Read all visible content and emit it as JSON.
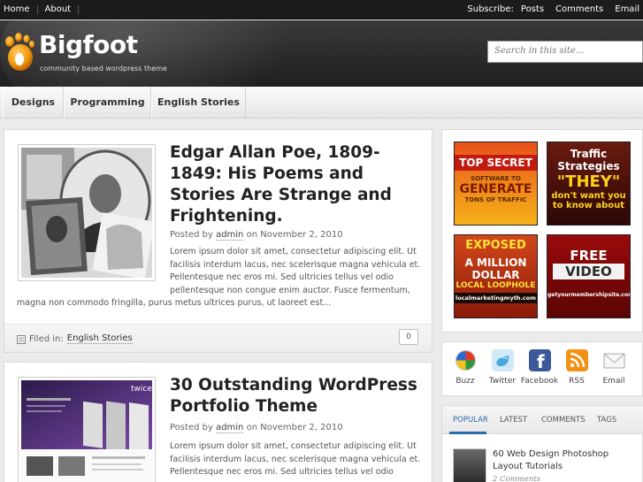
{
  "topbar": {
    "links": [
      "Home",
      "About"
    ],
    "subscribe_label": "Subscribe:",
    "subscribe_links": [
      "Posts",
      "Comments",
      "Email"
    ]
  },
  "header": {
    "site_title": "Bigfoot",
    "tagline": "community based wordpress theme",
    "search_placeholder": "Search in this site..."
  },
  "nav": {
    "items": [
      "Designs",
      "Programming",
      "English Stories"
    ]
  },
  "posts": [
    {
      "title": "Edgar Allan Poe, 1809-1849: His Poems and Stories Are Strange and Frightening.",
      "posted_by": "Posted by",
      "author": "admin",
      "date": "on November 2, 2010",
      "excerpt_lines": [
        "Lorem ipsum dolor sit amet, consectetur adipiscing elit. Ut",
        "facilisis interdum lacus, nec scelerisque magna vehicula et.",
        "Pellentesque nec eros mi. Sed ultricies tellus vel odio",
        "pellentesque non congue enim auctor. Fusce fermentum,",
        "magna non commodo fringilla, purus metus ultrices purus, ut laoreet est..."
      ],
      "filed_label": "Filed in:",
      "category": "English Stories",
      "comment_count": "0"
    },
    {
      "title": "30 Outstanding WordPress Portfolio Theme",
      "posted_by": "Posted by",
      "author": "admin",
      "date": "on November 2, 2010",
      "excerpt_lines": [
        "Lorem ipsum dolor sit amet, consectetur adipiscing elit. Ut",
        "facilisis interdum lacus, nec scelerisque magna vehicula et.",
        "Pellentesque nec eros mi. Sed ultricies tellus vel odio"
      ]
    }
  ],
  "ads": [
    {
      "lines": [
        "TOP SECRET",
        "SOFTWARE TO",
        "GENERATE",
        "TONS OF TRAFFIC"
      ]
    },
    {
      "lines": [
        "Traffic",
        "Strategies",
        "\"THEY\"",
        "don't want you",
        "to know about"
      ]
    },
    {
      "lines": [
        "EXPOSED",
        "A MILLION",
        "DOLLAR",
        "LOCAL LOOPHOLE",
        "localmarketingmyth.com"
      ]
    },
    {
      "lines": [
        "FREE",
        "VIDEO",
        "getyourmembershipsite.com"
      ]
    }
  ],
  "social": [
    "Buzz",
    "Twitter",
    "Facebook",
    "RSS",
    "Email"
  ],
  "tabs": [
    "POPULAR",
    "LATEST",
    "COMMENTS",
    "TAGS"
  ],
  "popular": {
    "title": "60 Web Design Photoshop Layout Tutorials",
    "comments": "2 Comments"
  }
}
